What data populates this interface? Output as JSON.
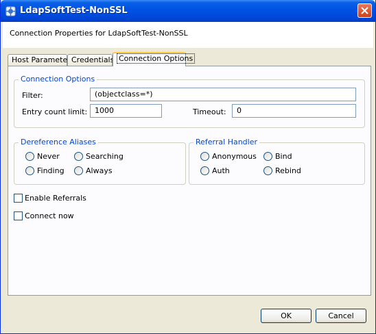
{
  "window": {
    "title": "LdapSoftTest-NonSSL"
  },
  "header": {
    "text": "Connection Properties for LdapSoftTest-NonSSL"
  },
  "tabs": [
    {
      "label": "Host Parameter"
    },
    {
      "label": "Credentials"
    },
    {
      "label": "Connection Options"
    }
  ],
  "connection_options": {
    "title": "Connection Options",
    "filter_label": "Filter:",
    "filter_value": "(objectclass=*)",
    "entry_limit_label": "Entry count limit:",
    "entry_limit_value": "1000",
    "timeout_label": "Timeout:",
    "timeout_value": "0"
  },
  "dereference": {
    "title": "Dereference Aliases",
    "options": [
      "Never",
      "Searching",
      "Finding",
      "Always"
    ]
  },
  "referral": {
    "title": "Referral Handler",
    "options": [
      "Anonymous",
      "Bind",
      "Auth",
      "Rebind"
    ]
  },
  "checkboxes": {
    "enable_referrals": "Enable Referrals",
    "connect_now": "Connect now"
  },
  "buttons": {
    "ok": "OK",
    "cancel": "Cancel"
  },
  "colors": {
    "titlebar": "#0052e3",
    "group_title": "#0046d5",
    "dialog_bg": "#ece9d8"
  }
}
